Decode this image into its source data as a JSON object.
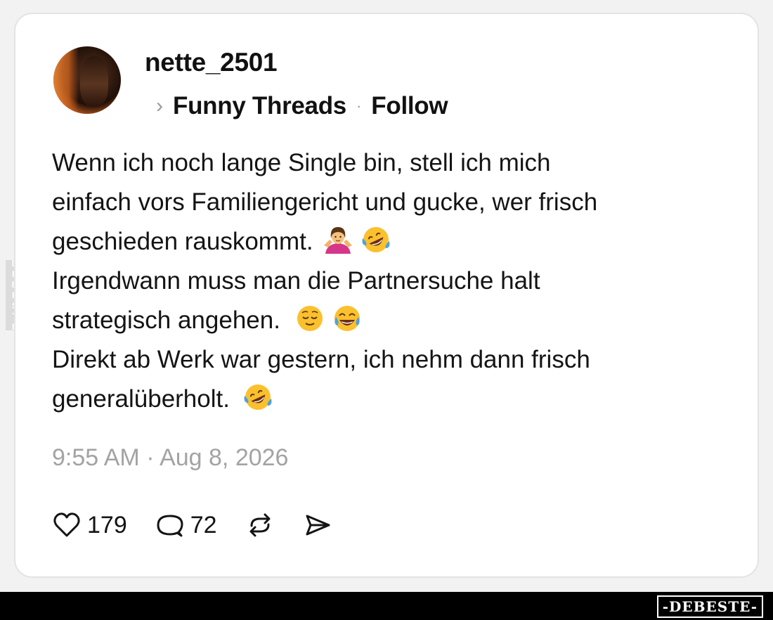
{
  "post": {
    "username": "nette_2501",
    "topic": "Funny Threads",
    "separator": "·",
    "follow_label": "Follow",
    "chevron": "›",
    "text_lines": [
      "Wenn ich noch lange Single bin, stell ich mich",
      "einfach vors Familiengericht und gucke, wer frisch",
      "geschieden rauskommt.",
      "Irgendwann muss man die Partnersuche halt",
      "strategisch angehen.",
      "Direkt ab Werk war gestern, ich nehm dann frisch",
      "generalüberholt."
    ],
    "emojis": {
      "line3": [
        "person-shrugging-emoji",
        "rofl-emoji"
      ],
      "line5": [
        "relieved-face-emoji",
        "tears-of-joy-emoji"
      ],
      "line7": [
        "rofl-emoji"
      ]
    },
    "timestamp": "9:55 AM · Aug 8, 2026"
  },
  "actions": {
    "likes": "179",
    "comments": "72",
    "icons": [
      "heart-icon",
      "comment-icon",
      "repost-icon",
      "share-icon"
    ]
  },
  "watermark": {
    "side": "DEBESTE",
    "footer": "-DEBESTE-"
  },
  "colors": {
    "background": "#f2f2f2",
    "card": "#ffffff",
    "text": "#141414",
    "muted": "#a3a3a3",
    "footer": "#000000"
  }
}
